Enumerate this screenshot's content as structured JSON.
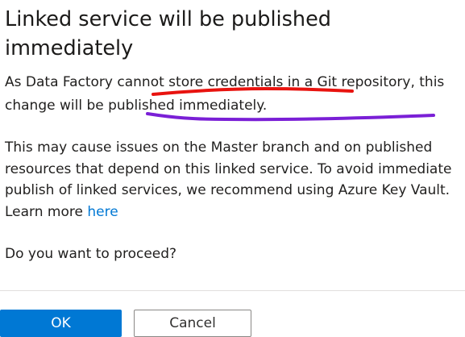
{
  "dialog": {
    "title": "Linked service will be published immediately",
    "paragraph1": "As Data Factory cannot store credentials in a Git repository, this change will be published immediately.",
    "paragraph2_text": "This may cause issues on the Master branch and on published resources that depend on this linked service. To avoid immediate publish of linked services, we recommend using Azure Key Vault. Learn more ",
    "paragraph2_link": "here",
    "question": "Do you want to proceed?",
    "ok_label": "OK",
    "cancel_label": "Cancel"
  },
  "annotations": {
    "underline1_color": "#e8130f",
    "underline2_color": "#7a1fd6"
  },
  "colors": {
    "primary": "#0078d4",
    "link": "#0078d4"
  }
}
